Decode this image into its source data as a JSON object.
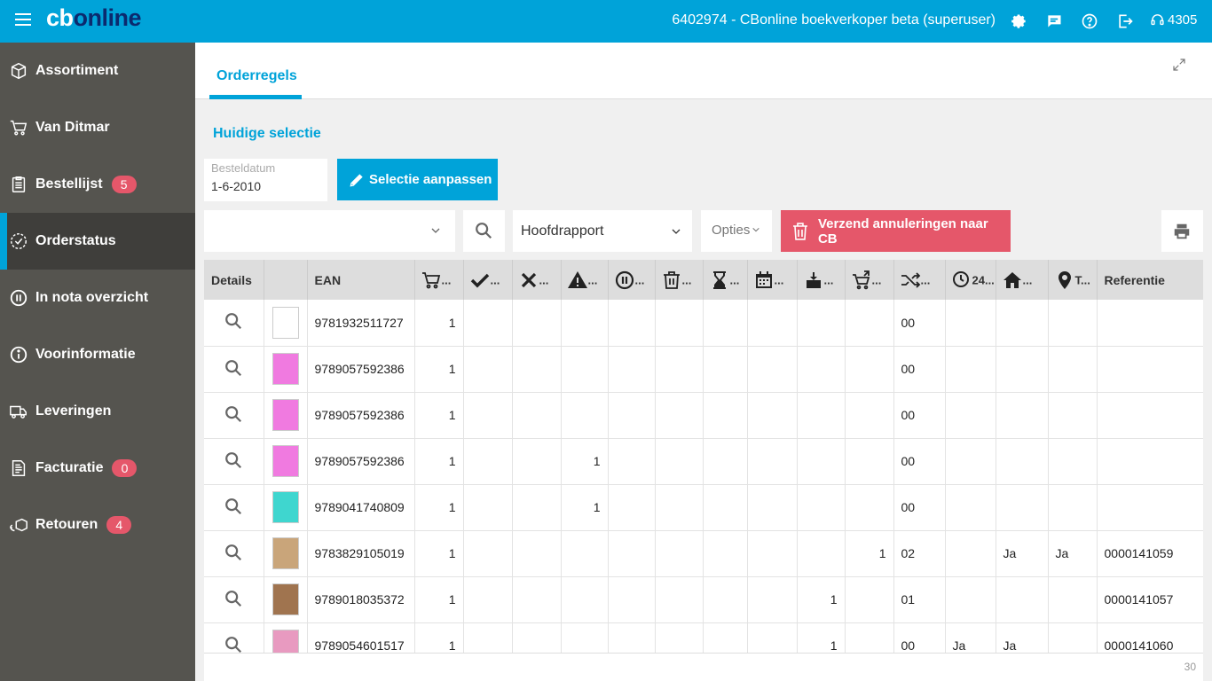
{
  "app": {
    "logo_part1": "cb",
    "logo_part2": "online",
    "title": "6402974 - CBonline boekverkoper beta (superuser)",
    "support_number": "4305"
  },
  "sidebar": {
    "items": [
      {
        "label": "Assortiment",
        "icon": "book-box-icon",
        "badge": ""
      },
      {
        "label": "Van Ditmar",
        "icon": "cart-icon",
        "badge": ""
      },
      {
        "label": "Bestellijst",
        "icon": "clipboard-icon",
        "badge": "5"
      },
      {
        "label": "Orderstatus",
        "icon": "clock-check-icon",
        "badge": "",
        "active": true
      },
      {
        "label": "In nota overzicht",
        "icon": "pause-circle-icon",
        "badge": ""
      },
      {
        "label": "Voorinformatie",
        "icon": "info-circle-icon",
        "badge": ""
      },
      {
        "label": "Leveringen",
        "icon": "delivery-truck-icon",
        "badge": ""
      },
      {
        "label": "Facturatie",
        "icon": "invoice-icon",
        "badge": "0"
      },
      {
        "label": "Retouren",
        "icon": "return-box-icon",
        "badge": "4"
      }
    ]
  },
  "main": {
    "tab_label": "Orderregels",
    "selection_title": "Huidige selectie",
    "date_label": "Besteldatum",
    "date_value": "1-6-2010",
    "edit_selection_label": "Selectie aanpassen",
    "combo_value": "",
    "report_value": "Hoofdrapport",
    "options_label": "Opties",
    "cancel_button_label": "Verzend annuleringen naar CB",
    "footer_count": "30"
  },
  "table": {
    "headers": {
      "details": "Details",
      "ean": "EAN",
      "referentie": "Referentie",
      "ellipsis": "...",
      "t_short": "T...",
      "h24": "24..."
    },
    "rows": [
      {
        "ean": "9781932511727",
        "c_order": "1",
        "c_ok": "",
        "c_x": "",
        "c_warn": "",
        "c_pause": "",
        "c_trash": "",
        "c_hour": "",
        "c_cal": "",
        "c_box": "",
        "c_cart": "",
        "c_route": "00",
        "c_24": "",
        "c_home": "",
        "c_pin": "",
        "ref": "",
        "cover": "#ffffff"
      },
      {
        "ean": "9789057592386",
        "c_order": "1",
        "c_ok": "",
        "c_x": "",
        "c_warn": "",
        "c_pause": "",
        "c_trash": "",
        "c_hour": "",
        "c_cal": "",
        "c_box": "",
        "c_cart": "",
        "c_route": "00",
        "c_24": "",
        "c_home": "",
        "c_pin": "",
        "ref": "",
        "cover": "#f07ae0"
      },
      {
        "ean": "9789057592386",
        "c_order": "1",
        "c_ok": "",
        "c_x": "",
        "c_warn": "",
        "c_pause": "",
        "c_trash": "",
        "c_hour": "",
        "c_cal": "",
        "c_box": "",
        "c_cart": "",
        "c_route": "00",
        "c_24": "",
        "c_home": "",
        "c_pin": "",
        "ref": "",
        "cover": "#f07ae0"
      },
      {
        "ean": "9789057592386",
        "c_order": "1",
        "c_ok": "",
        "c_x": "",
        "c_warn": "1",
        "c_pause": "",
        "c_trash": "",
        "c_hour": "",
        "c_cal": "",
        "c_box": "",
        "c_cart": "",
        "c_route": "00",
        "c_24": "",
        "c_home": "",
        "c_pin": "",
        "ref": "",
        "cover": "#f07ae0"
      },
      {
        "ean": "9789041740809",
        "c_order": "1",
        "c_ok": "",
        "c_x": "",
        "c_warn": "1",
        "c_pause": "",
        "c_trash": "",
        "c_hour": "",
        "c_cal": "",
        "c_box": "",
        "c_cart": "",
        "c_route": "00",
        "c_24": "",
        "c_home": "",
        "c_pin": "",
        "ref": "",
        "cover": "#3fd6cf"
      },
      {
        "ean": "9783829105019",
        "c_order": "1",
        "c_ok": "",
        "c_x": "",
        "c_warn": "",
        "c_pause": "",
        "c_trash": "",
        "c_hour": "",
        "c_cal": "",
        "c_box": "",
        "c_cart": "1",
        "c_route": "02",
        "c_24": "",
        "c_home": "Ja",
        "c_pin": "Ja",
        "ref": "0000141059",
        "cover": "#c9a57a"
      },
      {
        "ean": "9789018035372",
        "c_order": "1",
        "c_ok": "",
        "c_x": "",
        "c_warn": "",
        "c_pause": "",
        "c_trash": "",
        "c_hour": "",
        "c_cal": "",
        "c_box": "1",
        "c_cart": "",
        "c_route": "01",
        "c_24": "",
        "c_home": "",
        "c_pin": "",
        "ref": "0000141057",
        "cover": "#a0744f"
      },
      {
        "ean": "9789054601517",
        "c_order": "1",
        "c_ok": "",
        "c_x": "",
        "c_warn": "",
        "c_pause": "",
        "c_trash": "",
        "c_hour": "",
        "c_cal": "",
        "c_box": "1",
        "c_cart": "",
        "c_route": "00",
        "c_24": "Ja",
        "c_home": "Ja",
        "c_pin": "",
        "ref": "0000141060",
        "cover": "#e89ac0"
      }
    ]
  },
  "colors": {
    "brand": "#00a3d9",
    "sidebar": "#55544f",
    "danger": "#e5576a"
  }
}
